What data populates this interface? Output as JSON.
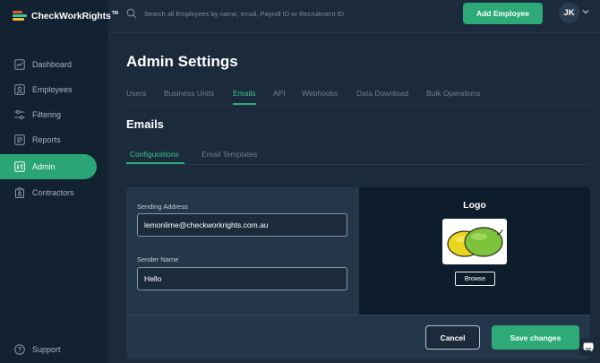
{
  "brand": {
    "name": "CheckWorkRights",
    "tm": "TM"
  },
  "search": {
    "placeholder": "Search all Employees by name, email, Payroll ID or Recruitment ID",
    "icon": "search-icon"
  },
  "header": {
    "add_employee_label": "Add Employee",
    "avatar_initials": "JK"
  },
  "sidebar": {
    "items": [
      {
        "label": "Dashboard",
        "icon": "dashboard-icon"
      },
      {
        "label": "Employees",
        "icon": "employees-icon"
      },
      {
        "label": "Filtering",
        "icon": "filter-icon"
      },
      {
        "label": "Reports",
        "icon": "reports-icon"
      },
      {
        "label": "Admin",
        "icon": "admin-icon",
        "active": true
      },
      {
        "label": "Contractors",
        "icon": "contractors-icon"
      }
    ],
    "support_label": "Support"
  },
  "page": {
    "title": "Admin Settings"
  },
  "tabs": [
    "Users",
    "Business Units",
    "Emails",
    "API",
    "Webhooks",
    "Data Download",
    "Bulk Operations"
  ],
  "active_tab": "Emails",
  "section": {
    "title": "Emails"
  },
  "subtabs": [
    "Configurations",
    "Email Templates"
  ],
  "active_subtab": "Configurations",
  "form": {
    "sending_address_label": "Sending Address",
    "sending_address_value": "lemonlime@checkworkrights.com.au",
    "sender_name_label": "Sender Name",
    "sender_name_value": "Hello"
  },
  "logo_panel": {
    "title": "Logo",
    "browse_label": "Browse"
  },
  "actions": {
    "cancel_label": "Cancel",
    "save_label": "Save changes"
  },
  "colors": {
    "accent": "#2eaa79",
    "sidebar": "#122231",
    "background": "#1b2b3c",
    "card": "#24364a",
    "logo_panel": "#0e1d2b"
  }
}
